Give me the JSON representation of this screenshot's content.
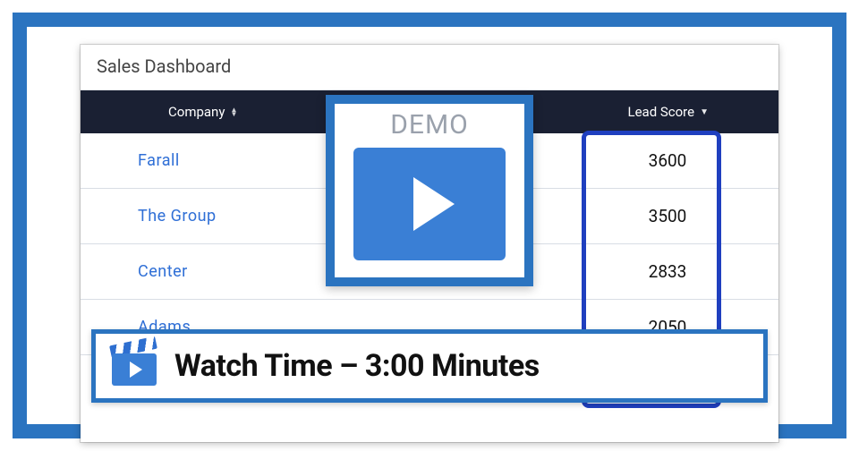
{
  "dashboard": {
    "title": "Sales Dashboard",
    "columns": {
      "company": "Company",
      "lead_score": "Lead Score"
    },
    "rows": [
      {
        "company": "Farall",
        "score": "3600"
      },
      {
        "company": "The  Group",
        "score": "3500"
      },
      {
        "company": "Center",
        "score": "2833"
      },
      {
        "company": "Adams",
        "score": "2050"
      }
    ]
  },
  "demo": {
    "label": "DEMO"
  },
  "banner": {
    "text": "Watch Time – 3:00 Minutes"
  }
}
